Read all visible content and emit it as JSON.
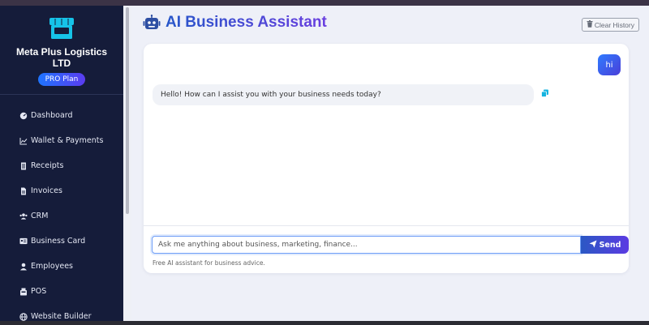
{
  "sidebar": {
    "company_name": "Meta Plus Logistics LTD",
    "plan_badge": "PRO Plan",
    "items": [
      {
        "label": "Dashboard",
        "icon": "dashboard-icon"
      },
      {
        "label": "Wallet & Payments",
        "icon": "chart-line-icon"
      },
      {
        "label": "Receipts",
        "icon": "receipt-icon"
      },
      {
        "label": "Invoices",
        "icon": "file-icon"
      },
      {
        "label": "CRM",
        "icon": "users-icon"
      },
      {
        "label": "Business Card",
        "icon": "id-card-icon"
      },
      {
        "label": "Employees",
        "icon": "user-icon"
      },
      {
        "label": "POS",
        "icon": "pos-icon"
      },
      {
        "label": "Website Builder",
        "icon": "globe-icon"
      }
    ]
  },
  "header": {
    "title": "AI Business Assistant",
    "clear_label": "Clear History"
  },
  "chat": {
    "user_message": "hi",
    "assistant_message": "Hello! How can I assist you with your business needs today?"
  },
  "composer": {
    "placeholder": "Ask me anything about business, marketing, finance...",
    "value": "",
    "send_label": "Send",
    "hint": "Free AI assistant for business advice."
  },
  "colors": {
    "sidebar_bg": "#151c3a",
    "accent_start": "#2b58c4",
    "accent_end": "#5b3be2",
    "store_icon": "#16c3e8"
  }
}
